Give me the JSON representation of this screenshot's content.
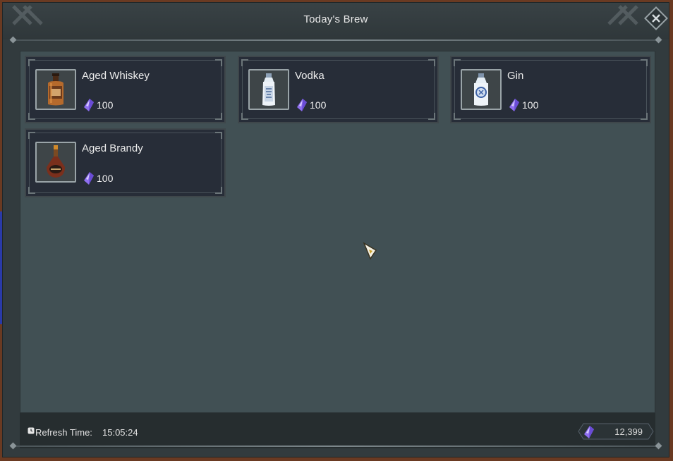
{
  "window": {
    "title": "Today's Brew"
  },
  "items": [
    {
      "name": "Aged Whiskey",
      "price": "100",
      "icon": "whiskey-bottle-icon"
    },
    {
      "name": "Vodka",
      "price": "100",
      "icon": "vodka-bottle-icon"
    },
    {
      "name": "Gin",
      "price": "100",
      "icon": "gin-bottle-icon"
    },
    {
      "name": "Aged Brandy",
      "price": "100",
      "icon": "brandy-bottle-icon"
    }
  ],
  "footer": {
    "refresh_label": "Refresh Time:",
    "refresh_time": "15:05:24",
    "currency_amount": "12,399",
    "currency_icon": "purple-crystal-icon"
  },
  "colors": {
    "panel": "#415054",
    "card": "#272d38",
    "crystal": "#8f6ff0"
  }
}
